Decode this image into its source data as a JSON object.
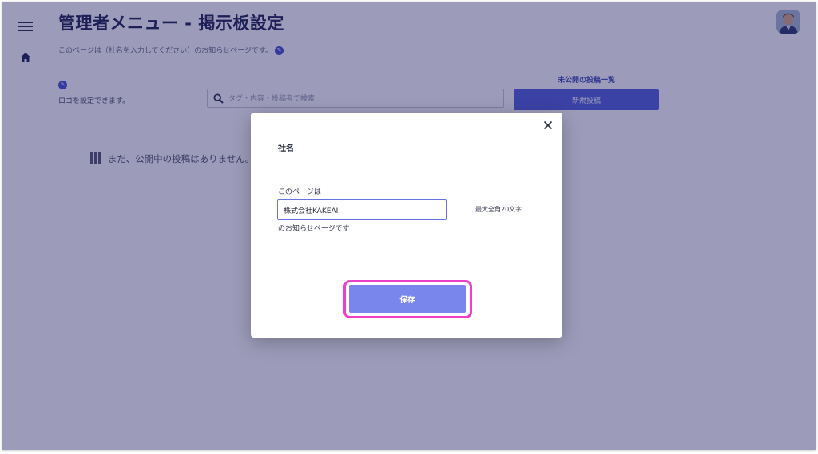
{
  "header": {
    "title": "管理者メニュー - 掲示板設定",
    "description": "このページは（社名を入力してください）のお知らせページです。"
  },
  "logo_section": {
    "text": "ロゴを設定できます。"
  },
  "search": {
    "placeholder": "タグ・内容・投稿者で検索",
    "value": ""
  },
  "actions": {
    "unpublished_label": "未公開の投稿一覧",
    "new_post_label": "新規投稿"
  },
  "empty_state": {
    "message": "まだ、公開中の投稿はありません。"
  },
  "modal": {
    "title": "社名",
    "prefix_label": "このページは",
    "company_value": "株式会社KAKEAI",
    "char_limit": "最大全角20文字",
    "suffix_label": "のお知らせページです",
    "save_label": "保存"
  },
  "icons": {
    "menu": "hamburger-menu-icon",
    "home": "home-icon",
    "info": "pencil-info-icon",
    "search": "search-icon",
    "grid": "grid-icon",
    "close": "close-icon"
  },
  "colors": {
    "accent": "#5260dc",
    "save_button": "#7987ec",
    "highlight": "#ec40c8",
    "overlay": "#1e1c5f"
  }
}
